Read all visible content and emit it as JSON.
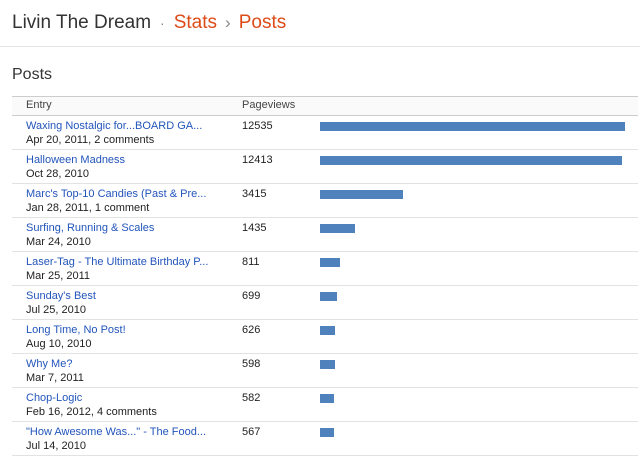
{
  "header": {
    "blog_name": "Livin The Dream",
    "separator_dot": "·",
    "stats_label": "Stats",
    "separator_arrow": "›",
    "posts_label": "Posts"
  },
  "section": {
    "title": "Posts"
  },
  "table": {
    "columns": {
      "entry": "Entry",
      "pageviews": "Pageviews"
    },
    "max_pageviews": 12535,
    "rows": [
      {
        "title": "Waxing Nostalgic for...BOARD GA...",
        "meta": "Apr 20, 2011, 2 comments",
        "pageviews": "12535",
        "value": 12535
      },
      {
        "title": "Halloween Madness",
        "meta": "Oct 28, 2010",
        "pageviews": "12413",
        "value": 12413
      },
      {
        "title": "Marc's Top-10 Candies (Past & Pre...",
        "meta": "Jan 28, 2011, 1 comment",
        "pageviews": "3415",
        "value": 3415
      },
      {
        "title": "Surfing, Running & Scales",
        "meta": "Mar 24, 2010",
        "pageviews": "1435",
        "value": 1435
      },
      {
        "title": "Laser-Tag - The Ultimate Birthday P...",
        "meta": "Mar 25, 2011",
        "pageviews": "811",
        "value": 811
      },
      {
        "title": "Sunday's Best",
        "meta": "Jul 25, 2010",
        "pageviews": "699",
        "value": 699
      },
      {
        "title": "Long Time, No Post!",
        "meta": "Aug 10, 2010",
        "pageviews": "626",
        "value": 626
      },
      {
        "title": "Why Me?",
        "meta": "Mar 7, 2011",
        "pageviews": "598",
        "value": 598
      },
      {
        "title": "Chop-Logic",
        "meta": "Feb 16, 2012, 4 comments",
        "pageviews": "582",
        "value": 582
      },
      {
        "title": "\"How Awesome Was...\" - The Food...",
        "meta": "Jul 14, 2010",
        "pageviews": "567",
        "value": 567
      }
    ]
  },
  "colors": {
    "accent": "#dd4b17",
    "link": "#2255bb",
    "bar": "#4f81bd"
  }
}
